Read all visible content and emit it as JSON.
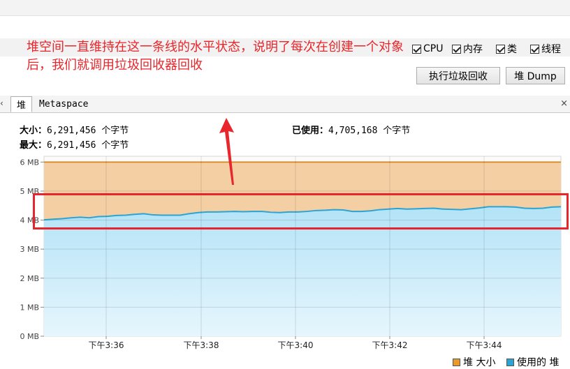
{
  "annotation": {
    "text": "堆空间一直维持在这一条线的水平状态，说明了每次在创建一个对象后，我们就调用垃圾回收器回收",
    "color": "#e8262b"
  },
  "checkboxes": [
    {
      "label": "CPU",
      "checked": true
    },
    {
      "label": "内存",
      "checked": true
    },
    {
      "label": "类",
      "checked": true
    },
    {
      "label": "线程",
      "checked": true
    }
  ],
  "buttons": {
    "gc_label": "执行垃圾回收",
    "dump_label": "堆 Dump"
  },
  "tabs": [
    {
      "label": "堆",
      "active": true
    },
    {
      "label": "Metaspace",
      "active": false
    }
  ],
  "tab_scroll_icon": "chevron-left-icon",
  "close_icon_label": "×",
  "left_arrow_label": "‹",
  "stats": {
    "size_label": "大小：",
    "size_value": "6,291,456",
    "max_label": "最大：",
    "max_value": "6,291,456",
    "used_label": "已使用：",
    "used_value": "4,705,168",
    "unit": "个字节"
  },
  "chart_data": {
    "type": "area",
    "title": "",
    "xlabel": "",
    "ylabel": "",
    "x_ticks": [
      "下午3:36",
      "下午3:38",
      "下午3:40",
      "下午3:42",
      "下午3:44"
    ],
    "y_ticks": [
      "0 MB",
      "1 MB",
      "2 MB",
      "3 MB",
      "4 MB",
      "5 MB",
      "6 MB"
    ],
    "ylim": [
      0,
      6.2
    ],
    "grid": true,
    "legend_position": "bottom-right",
    "series": [
      {
        "name": "堆 大小",
        "color": "#e89a2c",
        "fill": "#f5cfa4",
        "values": [
          6.0,
          6.0,
          6.0,
          6.0,
          6.0,
          6.0,
          6.0,
          6.0,
          6.0,
          6.0,
          6.0,
          6.0,
          6.0,
          6.0,
          6.0,
          6.0,
          6.0,
          6.0,
          6.0,
          6.0,
          6.0,
          6.0,
          6.0,
          6.0,
          6.0,
          6.0,
          6.0,
          6.0,
          6.0,
          6.0,
          6.0,
          6.0,
          6.0,
          6.0,
          6.0,
          6.0,
          6.0,
          6.0,
          6.0,
          6.0,
          6.0,
          6.0,
          6.0,
          6.0,
          6.0,
          6.0,
          6.0,
          6.0,
          6.0,
          6.0,
          6.0,
          6.0,
          6.0,
          6.0,
          6.0
        ]
      },
      {
        "name": "使用的 堆",
        "color": "#2ba4d3",
        "fill": "#b4e3f7",
        "values": [
          4.01,
          4.03,
          4.05,
          4.08,
          4.1,
          4.08,
          4.12,
          4.13,
          4.16,
          4.17,
          4.2,
          4.22,
          4.18,
          4.17,
          4.17,
          4.17,
          4.22,
          4.26,
          4.28,
          4.28,
          4.29,
          4.3,
          4.29,
          4.3,
          4.3,
          4.27,
          4.26,
          4.28,
          4.28,
          4.3,
          4.33,
          4.34,
          4.36,
          4.35,
          4.3,
          4.3,
          4.32,
          4.36,
          4.38,
          4.4,
          4.38,
          4.39,
          4.4,
          4.41,
          4.38,
          4.37,
          4.36,
          4.39,
          4.42,
          4.46,
          4.46,
          4.46,
          4.45,
          4.41,
          4.4,
          4.41,
          4.45,
          4.46
        ]
      }
    ]
  }
}
